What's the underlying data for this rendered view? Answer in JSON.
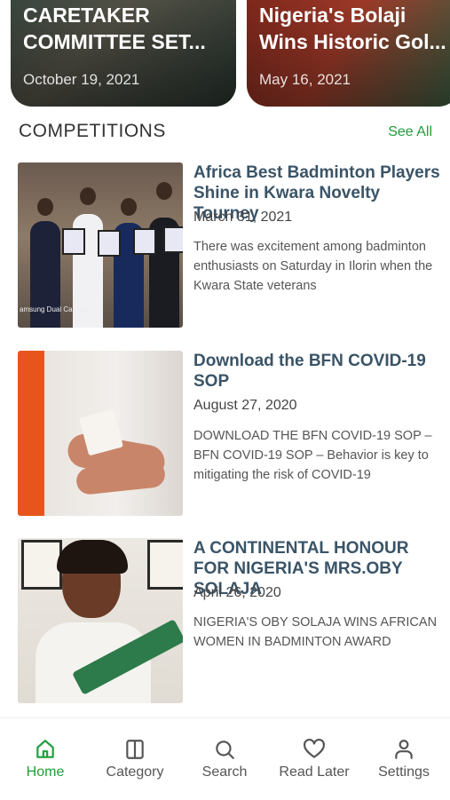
{
  "carousel": [
    {
      "title": "CARETAKER\nCOMMITTEE SET...",
      "date": "October 19, 2021"
    },
    {
      "title": "Nigeria's Bolaji\nWins Historic Gol...",
      "date": "May 16, 2021"
    }
  ],
  "section": {
    "title": "COMPETITIONS",
    "see_all": "See All"
  },
  "articles": [
    {
      "title": "Africa Best Badminton Players Shine in Kwara Novelty Tourney",
      "date": "March 31, 2021",
      "excerpt": "There was excitement among badminton enthusiasts on Saturday in Ilorin when the Kwara State veterans",
      "thumb_caption": "amsung Dual Camera"
    },
    {
      "title": "Download the BFN COVID-19 SOP",
      "date": "August 27, 2020",
      "excerpt": "DOWNLOAD THE BFN COVID-19 SOP – BFN COVID-19 SOP – Behavior is key to mitigating the risk of COVID-19"
    },
    {
      "title": "A CONTINENTAL HONOUR FOR NIGERIA'S MRS.OBY SOLAJA",
      "date": "April 26, 2020",
      "excerpt": "NIGERIA'S OBY SOLAJA WINS AFRICAN WOMEN IN BADMINTON AWARD"
    }
  ],
  "nav": {
    "items": [
      {
        "label": "Home",
        "icon": "home-icon",
        "active": true
      },
      {
        "label": "Category",
        "icon": "category-icon",
        "active": false
      },
      {
        "label": "Search",
        "icon": "search-icon",
        "active": false
      },
      {
        "label": "Read Later",
        "icon": "heart-icon",
        "active": false
      },
      {
        "label": "Settings",
        "icon": "user-icon",
        "active": false
      }
    ]
  },
  "colors": {
    "accent": "#1e9e3a",
    "title": "#3a5467"
  }
}
